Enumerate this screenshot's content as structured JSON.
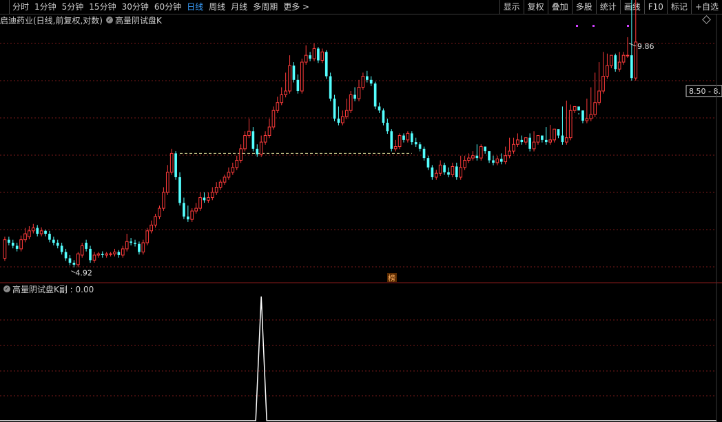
{
  "toolbar": {
    "timeframes": [
      "分时",
      "1分钟",
      "5分钟",
      "15分钟",
      "30分钟",
      "60分钟",
      "日线",
      "周线",
      "月线",
      "多周期",
      "更多 >"
    ],
    "active": "日线",
    "right_buttons": [
      "显示",
      "复权",
      "叠加",
      "多股",
      "统计",
      "画线",
      "F10",
      "标记",
      "+自选"
    ]
  },
  "main_title": {
    "stock": "启迪药业(日线,前复权,对数)",
    "indicator": "高量阴试盘K"
  },
  "sub_title": "高量阴试盘K副 : 0.00",
  "annotations": {
    "high_label": "9.86",
    "low_label": "4.92",
    "price_box": "8.50 - 8.",
    "bang_label": "榜"
  },
  "colors": {
    "up": "#ff3b3b",
    "down": "#54ffff",
    "grid": "#7a1a1a",
    "support_line": "#e6e6a0",
    "indicator_line": "#ffffff"
  },
  "chart_data": [
    {
      "type": "candlestick",
      "title": "启迪药业(日线,前复权,对数)",
      "scale": "log",
      "ylim": [
        4.7,
        10.4
      ],
      "support_level": 7.0,
      "marked_high": 9.86,
      "marked_low": 4.92,
      "x_index": [
        1,
        2,
        3,
        4,
        5,
        6,
        7,
        8,
        9,
        10,
        11,
        12,
        13,
        14,
        15,
        16,
        17,
        18,
        19,
        20,
        21,
        22,
        23,
        24,
        25,
        26,
        27,
        28,
        29,
        30,
        31,
        32,
        33,
        34,
        35,
        36,
        37,
        38,
        39,
        40,
        41,
        42,
        43,
        44,
        45,
        46,
        47,
        48,
        49,
        50,
        51,
        52,
        53,
        54,
        55,
        56,
        57,
        58,
        59,
        60,
        61,
        62,
        63,
        64,
        65,
        66,
        67,
        68,
        69,
        70,
        71,
        72,
        73,
        74,
        75,
        76,
        77,
        78,
        79,
        80,
        81,
        82,
        83,
        84,
        85,
        86,
        87,
        88,
        89,
        90,
        91,
        92,
        93,
        94,
        95,
        96,
        97,
        98,
        99,
        100,
        101,
        102,
        103,
        104,
        105,
        106,
        107,
        108,
        109,
        110,
        111,
        112,
        113,
        114,
        115,
        116,
        117,
        118,
        119,
        120,
        121,
        122,
        123,
        124,
        125,
        126,
        127,
        128,
        129,
        130,
        131,
        132,
        133,
        134,
        135,
        136,
        137,
        138,
        139,
        140,
        141,
        142,
        143,
        144,
        145,
        146,
        147,
        148,
        149,
        150,
        151,
        152,
        153,
        154,
        155,
        156,
        157,
        158,
        159,
        160,
        161,
        162,
        163,
        164,
        165,
        166,
        167,
        168,
        169,
        170,
        171,
        172,
        173,
        174,
        175
      ],
      "open": [
        5.05,
        5.35,
        5.3,
        5.25,
        5.2,
        5.35,
        5.4,
        5.5,
        5.55,
        5.45,
        5.5,
        5.45,
        5.35,
        5.3,
        5.25,
        5.15,
        5.05,
        4.98,
        4.95,
        5.1,
        5.3,
        5.2,
        5.02,
        5.1,
        5.12,
        5.1,
        5.12,
        5.12,
        5.15,
        5.1,
        5.2,
        5.32,
        5.3,
        5.28,
        5.15,
        5.3,
        5.5,
        5.6,
        5.75,
        5.9,
        6.2,
        6.6,
        7.0,
        6.5,
        6.0,
        5.75,
        5.7,
        5.85,
        5.9,
        6.1,
        6.05,
        6.1,
        6.2,
        6.3,
        6.4,
        6.5,
        6.6,
        6.7,
        6.85,
        7.1,
        7.4,
        7.5,
        7.1,
        6.98,
        7.25,
        7.4,
        7.6,
        8.0,
        8.2,
        8.4,
        8.5,
        9.2,
        8.8,
        8.5,
        9.3,
        9.5,
        9.4,
        9.7,
        9.35,
        9.6,
        8.9,
        8.3,
        7.8,
        7.7,
        7.85,
        8.0,
        8.4,
        8.3,
        8.6,
        8.9,
        8.8,
        8.7,
        8.1,
        8.0,
        7.7,
        7.5,
        7.1,
        7.15,
        7.4,
        7.3,
        7.45,
        7.25,
        7.2,
        7.1,
        6.9,
        6.7,
        6.5,
        6.58,
        6.75,
        6.6,
        6.55,
        6.72,
        6.5,
        6.7,
        6.85,
        6.9,
        6.95,
        6.9,
        7.15,
        7.05,
        6.85,
        6.8,
        6.88,
        6.82,
        6.95,
        7.05,
        7.2,
        7.3,
        7.25,
        7.35,
        7.1,
        7.25,
        7.4,
        7.3,
        7.25,
        7.3,
        7.55,
        7.4,
        7.25,
        7.35,
        8.0,
        8.1,
        8.0,
        7.75,
        7.8,
        7.9,
        8.2,
        8.5,
        8.9,
        9.2,
        9.5,
        9.1,
        9.3,
        9.5,
        9.5,
        8.85
      ],
      "close": [
        5.35,
        5.3,
        5.25,
        5.2,
        5.35,
        5.45,
        5.5,
        5.55,
        5.45,
        5.5,
        5.45,
        5.35,
        5.3,
        5.25,
        5.15,
        5.05,
        4.98,
        4.95,
        5.12,
        5.25,
        5.2,
        5.02,
        5.1,
        5.12,
        5.1,
        5.12,
        5.12,
        5.15,
        5.1,
        5.2,
        5.32,
        5.3,
        5.28,
        5.15,
        5.3,
        5.5,
        5.6,
        5.75,
        5.9,
        6.2,
        6.6,
        7.0,
        6.5,
        6.0,
        5.75,
        5.7,
        5.85,
        5.9,
        6.1,
        6.05,
        6.1,
        6.2,
        6.3,
        6.4,
        6.5,
        6.6,
        6.7,
        6.85,
        7.1,
        7.4,
        7.5,
        7.1,
        6.98,
        7.25,
        7.4,
        7.6,
        8.0,
        8.2,
        8.4,
        8.5,
        9.2,
        8.8,
        8.5,
        9.3,
        9.5,
        9.4,
        9.7,
        9.35,
        9.6,
        8.9,
        8.3,
        7.8,
        7.7,
        7.85,
        8.0,
        8.4,
        8.3,
        8.6,
        8.9,
        8.8,
        8.7,
        8.1,
        8.0,
        7.7,
        7.5,
        7.1,
        7.15,
        7.4,
        7.3,
        7.45,
        7.25,
        7.2,
        7.1,
        6.9,
        6.7,
        6.5,
        6.58,
        6.75,
        6.6,
        6.55,
        6.72,
        6.5,
        6.7,
        6.85,
        6.9,
        6.95,
        6.9,
        7.15,
        7.05,
        6.85,
        6.8,
        6.88,
        6.82,
        6.95,
        7.05,
        7.2,
        7.3,
        7.25,
        7.35,
        7.1,
        7.25,
        7.4,
        7.3,
        7.25,
        7.3,
        7.55,
        7.4,
        7.25,
        7.35,
        8.0,
        8.1,
        8.0,
        7.75,
        7.8,
        7.9,
        8.2,
        8.5,
        8.9,
        9.2,
        9.5,
        9.1,
        9.3,
        9.5,
        9.5,
        8.85,
        9.9
      ],
      "high": [
        5.4,
        5.4,
        5.35,
        5.3,
        5.42,
        5.55,
        5.58,
        5.62,
        5.6,
        5.56,
        5.52,
        5.5,
        5.4,
        5.35,
        5.3,
        5.2,
        5.1,
        5.02,
        5.15,
        5.3,
        5.35,
        5.25,
        5.15,
        5.15,
        5.16,
        5.15,
        5.15,
        5.2,
        5.18,
        5.25,
        5.45,
        5.38,
        5.35,
        5.32,
        5.35,
        5.55,
        5.68,
        5.8,
        5.95,
        6.3,
        6.75,
        7.1,
        7.05,
        6.6,
        6.1,
        5.95,
        5.9,
        6.0,
        6.2,
        6.2,
        6.2,
        6.3,
        6.4,
        6.45,
        6.55,
        6.7,
        6.8,
        6.95,
        7.2,
        7.5,
        7.8,
        7.6,
        7.2,
        7.4,
        7.5,
        7.8,
        8.1,
        8.35,
        8.6,
        9.0,
        9.5,
        9.3,
        8.95,
        9.4,
        9.8,
        9.6,
        9.86,
        9.75,
        9.7,
        9.65,
        9.0,
        8.4,
        8.1,
        8.0,
        8.3,
        8.5,
        8.6,
        8.8,
        9.0,
        9.05,
        8.9,
        8.75,
        8.2,
        8.05,
        7.8,
        7.55,
        7.3,
        7.45,
        7.45,
        7.5,
        7.5,
        7.35,
        7.25,
        7.15,
        6.95,
        6.75,
        6.65,
        6.85,
        6.8,
        6.7,
        6.8,
        6.8,
        6.95,
        6.95,
        7.0,
        7.05,
        7.2,
        7.2,
        7.1,
        6.95,
        6.95,
        6.95,
        7.0,
        7.15,
        7.35,
        7.35,
        7.45,
        7.4,
        7.35,
        7.45,
        7.5,
        7.4,
        7.35,
        7.6,
        7.65,
        7.5,
        7.45,
        8.1,
        8.25,
        8.15,
        8.0,
        7.9,
        8.0,
        8.3,
        8.6,
        9.0,
        9.3,
        9.6,
        9.55,
        9.35,
        9.55,
        9.6,
        9.6,
        10.05
      ]
    },
    {
      "type": "line",
      "title": "高量阴试盘K副",
      "current_value": 0.0,
      "ylim": [
        0,
        1
      ],
      "spike_at_index": 63,
      "spike_value": 1
    }
  ]
}
